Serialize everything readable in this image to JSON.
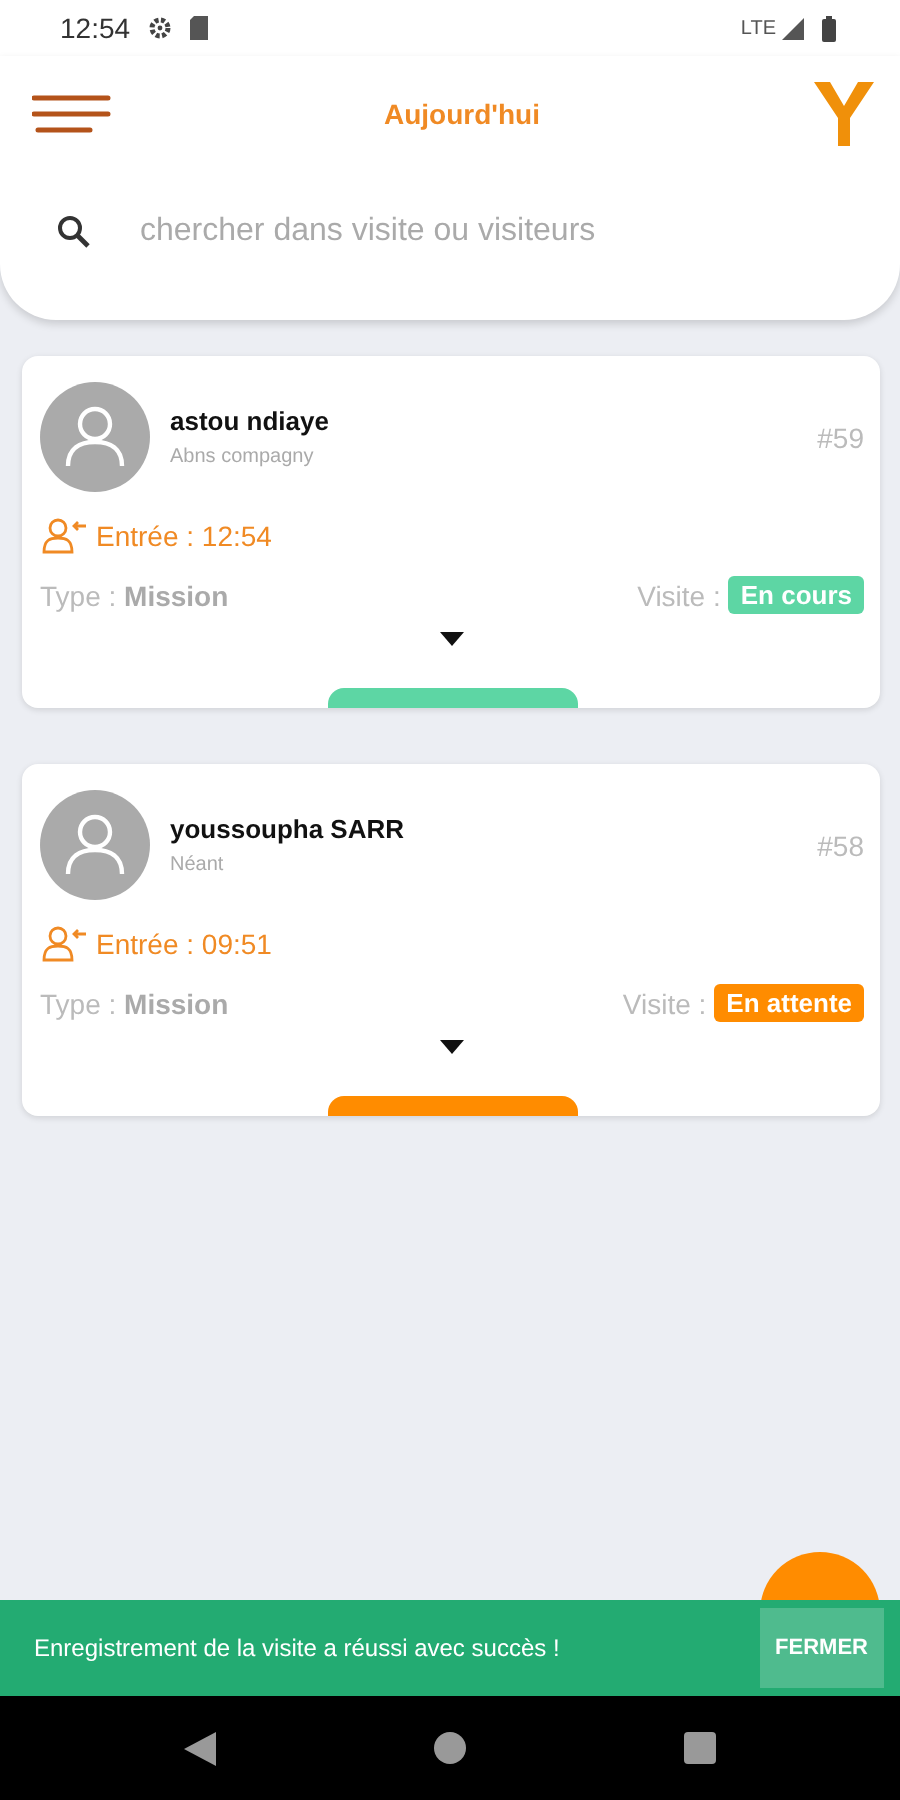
{
  "status_bar": {
    "time": "12:54",
    "network": "LTE"
  },
  "header": {
    "title": "Aujourd'hui"
  },
  "search": {
    "placeholder": "chercher dans visite ou visiteurs"
  },
  "visits": [
    {
      "name": "astou ndiaye",
      "company": "Abns compagny",
      "number": "#59",
      "entry": "Entrée : 12:54",
      "type_label": "Type :",
      "type": "Mission",
      "visit_label": "Visite :",
      "status": "En cours",
      "color": "#5dd6a4"
    },
    {
      "name": "youssoupha SARR",
      "company": "Néant",
      "number": "#58",
      "entry": "Entrée : 09:51",
      "type_label": "Type :",
      "type": "Mission",
      "visit_label": "Visite :",
      "status": "En attente",
      "color": "#ff8c00"
    }
  ],
  "snackbar": {
    "message": "Enregistrement de la visite a réussi avec succès !",
    "action": "FERMER"
  }
}
